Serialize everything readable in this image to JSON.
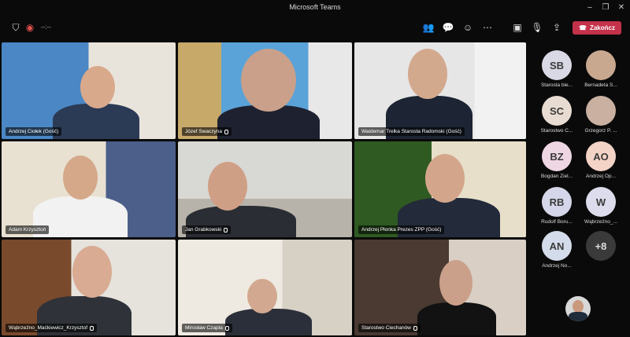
{
  "window": {
    "title": "Microsoft Teams"
  },
  "toolbar": {
    "timer": "--:--",
    "end_label": "Zakończ",
    "icons": [
      "people-icon",
      "chat-icon",
      "reactions-icon",
      "more-icon",
      "camera-off-icon",
      "mic-off-icon",
      "share-icon"
    ]
  },
  "tiles": [
    {
      "name": "Andrzej Ciołek (Gość)"
    },
    {
      "name": "Józef Swaczyna"
    },
    {
      "name": "Waldemar Trelka Starosta Radomski (Gość)"
    },
    {
      "name": "Adam Krzysztoń"
    },
    {
      "name": "Jan Grabkowski"
    },
    {
      "name": "Andrzej Płonka Prezes ZPP (Gość)"
    },
    {
      "name": "Wąbrzeźno_Maćkiewicz_Krzysztof"
    },
    {
      "name": "Mirosław Czapla"
    },
    {
      "name": "Starostwo Ciechanów"
    }
  ],
  "roster": [
    {
      "initials": "SB",
      "label": "Starosta bie...",
      "color": "#d9d9e6"
    },
    {
      "initials": "",
      "label": "Bernadeta S...",
      "color": "#c9a890"
    },
    {
      "initials": "SC",
      "label": "Starostwo C...",
      "color": "#e8dcd2"
    },
    {
      "initials": "",
      "label": "Grzegorz P. ...",
      "color": "#c9b0a0"
    },
    {
      "initials": "BZ",
      "label": "Bogdan Ziel...",
      "color": "#efd6e3"
    },
    {
      "initials": "AO",
      "label": "Andrzej Op...",
      "color": "#f3d3c6"
    },
    {
      "initials": "RB",
      "label": "Rudolf Boru...",
      "color": "#d6d6ea"
    },
    {
      "initials": "W",
      "label": "Wąbrzeźno_...",
      "color": "#dcdcec"
    },
    {
      "initials": "AN",
      "label": "Andrzej No...",
      "color": "#d4dbea"
    },
    {
      "initials": "+8",
      "label": "",
      "color": "#3a3a3a"
    }
  ]
}
